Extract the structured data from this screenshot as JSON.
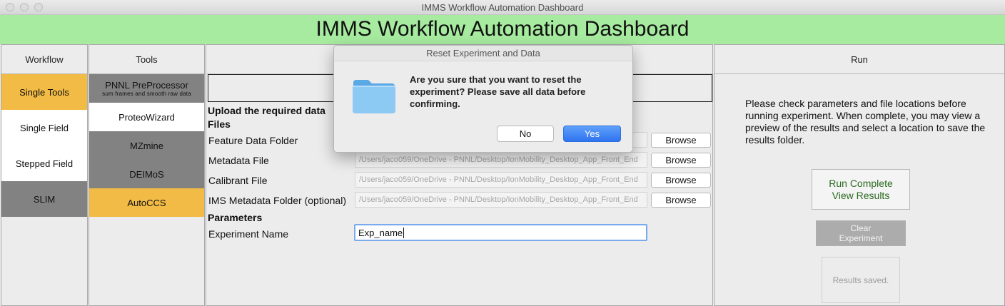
{
  "window": {
    "title": "IMMS Workflow Automation Dashboard"
  },
  "banner": {
    "title": "IMMS Workflow Automation Dashboard"
  },
  "workflow": {
    "header": "Workflow",
    "items": [
      {
        "label": "Single Tools"
      },
      {
        "label": "Single Field"
      },
      {
        "label": "Stepped Field"
      },
      {
        "label": "SLIM"
      }
    ]
  },
  "tools": {
    "header": "Tools",
    "items": [
      {
        "label": "PNNL PreProcessor",
        "sub": "sum frames and smooth raw data"
      },
      {
        "label": "ProteoWizard"
      },
      {
        "label": "MZmine"
      },
      {
        "label": "DEIMoS"
      },
      {
        "label": "AutoCCS"
      }
    ]
  },
  "form": {
    "upload_heading": "Upload the required data",
    "files_heading": "Files",
    "rows": [
      {
        "label": "Feature Data Folder",
        "value": "",
        "browse": "Browse"
      },
      {
        "label": "Metadata File",
        "value": "/Users/jaco059/OneDrive - PNNL/Desktop/IonMobility_Desktop_App_Front_End",
        "browse": "Browse"
      },
      {
        "label": "Calibrant File",
        "value": "/Users/jaco059/OneDrive - PNNL/Desktop/IonMobility_Desktop_App_Front_End",
        "browse": "Browse"
      },
      {
        "label": "IMS Metadata Folder (optional)",
        "value": "/Users/jaco059/OneDrive - PNNL/Desktop/IonMobility_Desktop_App_Front_End",
        "browse": "Browse"
      }
    ],
    "params_heading": "Parameters",
    "experiment_label": "Experiment Name",
    "experiment_value": "Exp_name"
  },
  "run": {
    "header": "Run",
    "message": "Please check parameters and file locations before running experiment. When complete, you may view a preview of the results and select a location to save the results folder.",
    "run_button_line1": "Run Complete",
    "run_button_line2": "View Results",
    "clear_button_line1": "Clear",
    "clear_button_line2": "Experiment",
    "results_status": "Results saved."
  },
  "dialog": {
    "title": "Reset Experiment and Data",
    "message": "Are you sure that you want to reset the experiment? Please save all data before confirming.",
    "no": "No",
    "yes": "Yes",
    "icon": "folder-icon"
  },
  "colors": {
    "banner": "#a6eb9f",
    "selected": "#f2bb45",
    "disabled": "#828282",
    "accent": "#3478f6",
    "run_text": "#2a6a1f"
  }
}
